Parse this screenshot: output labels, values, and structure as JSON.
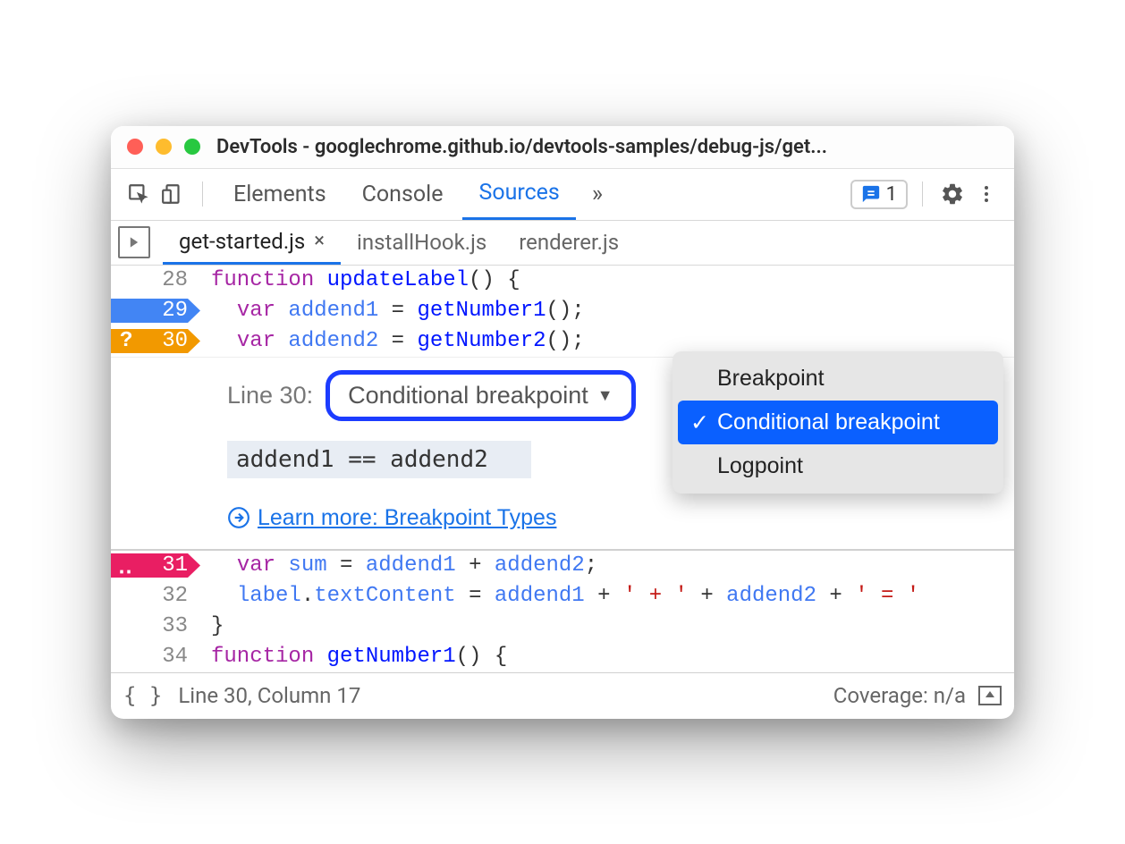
{
  "window": {
    "title": "DevTools - googlechrome.github.io/devtools-samples/debug-js/get..."
  },
  "toolbar": {
    "tabs": [
      "Elements",
      "Console",
      "Sources"
    ],
    "active_tab": "Sources",
    "issues_count": "1"
  },
  "file_tabs": {
    "items": [
      {
        "name": "get-started.js",
        "active": true,
        "closable": true
      },
      {
        "name": "installHook.js",
        "active": false,
        "closable": false
      },
      {
        "name": "renderer.js",
        "active": false,
        "closable": false
      }
    ]
  },
  "code": {
    "lines": [
      {
        "n": "28",
        "bp": "",
        "tokens": [
          [
            "kw",
            "function"
          ],
          [
            "",
            ""
          ],
          [
            "fn",
            " updateLabel"
          ],
          [
            "punct",
            "() {"
          ]
        ]
      },
      {
        "n": "29",
        "bp": "blue",
        "tokens": [
          [
            "",
            "  "
          ],
          [
            "kw",
            "var"
          ],
          [
            "",
            ""
          ],
          [
            "var",
            " addend1"
          ],
          [
            "op",
            " = "
          ],
          [
            "fn",
            "getNumber1"
          ],
          [
            "punct",
            "();"
          ]
        ]
      },
      {
        "n": "30",
        "bp": "orange",
        "tokens": [
          [
            "",
            "  "
          ],
          [
            "kw",
            "var"
          ],
          [
            "",
            ""
          ],
          [
            "var",
            " addend2"
          ],
          [
            "op",
            " = "
          ],
          [
            "fn",
            "getNumber2"
          ],
          [
            "punct",
            "();"
          ]
        ]
      },
      {
        "n": "31",
        "bp": "pink",
        "tokens": [
          [
            "",
            "  "
          ],
          [
            "kw",
            "var"
          ],
          [
            "",
            ""
          ],
          [
            "var",
            " sum"
          ],
          [
            "op",
            " = "
          ],
          [
            "var",
            "addend1"
          ],
          [
            "op",
            " + "
          ],
          [
            "var",
            "addend2"
          ],
          [
            "punct",
            ";"
          ]
        ]
      },
      {
        "n": "32",
        "bp": "",
        "tokens": [
          [
            "",
            "  "
          ],
          [
            "var",
            "label"
          ],
          [
            "punct",
            "."
          ],
          [
            "var",
            "textContent"
          ],
          [
            "op",
            " = "
          ],
          [
            "var",
            "addend1"
          ],
          [
            "op",
            " + "
          ],
          [
            "str",
            "' + '"
          ],
          [
            "op",
            " + "
          ],
          [
            "var",
            "addend2"
          ],
          [
            "op",
            " + "
          ],
          [
            "str",
            "' = '"
          ]
        ]
      },
      {
        "n": "33",
        "bp": "",
        "tokens": [
          [
            "punct",
            "}"
          ]
        ]
      },
      {
        "n": "34",
        "bp": "",
        "tokens": [
          [
            "kw",
            "function"
          ],
          [
            "",
            ""
          ],
          [
            "fn",
            " getNumber1"
          ],
          [
            "punct",
            "() {"
          ]
        ]
      }
    ]
  },
  "breakpoint_editor": {
    "line_label": "Line 30:",
    "dropdown_label": "Conditional breakpoint",
    "condition": "addend1 == addend2",
    "learn_more": "Learn more: Breakpoint Types"
  },
  "dropdown_menu": {
    "items": [
      {
        "label": "Breakpoint",
        "selected": false
      },
      {
        "label": "Conditional breakpoint",
        "selected": true
      },
      {
        "label": "Logpoint",
        "selected": false
      }
    ]
  },
  "statusbar": {
    "position": "Line 30, Column 17",
    "coverage": "Coverage: n/a"
  }
}
